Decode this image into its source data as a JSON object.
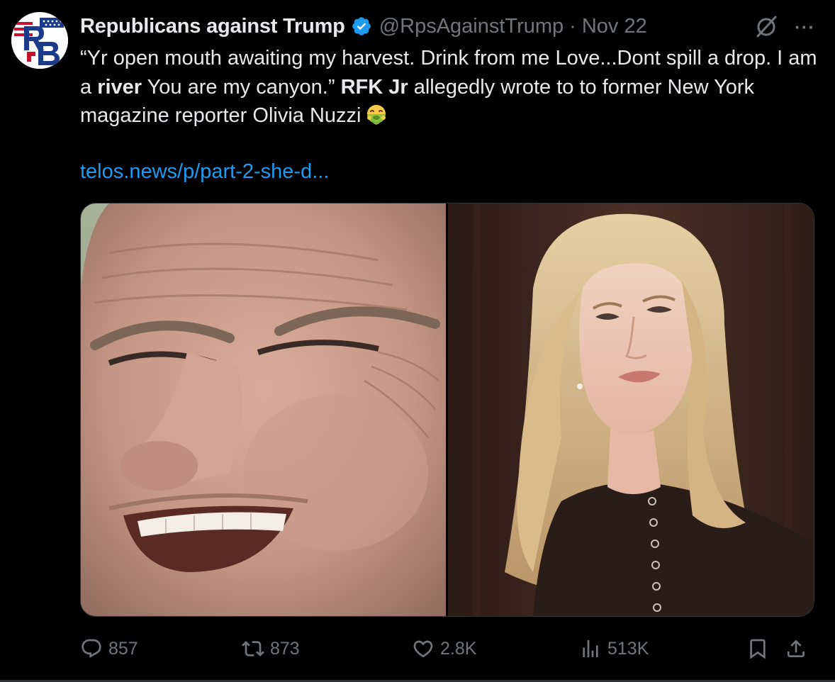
{
  "author": {
    "display_name": "Republicans against Trump",
    "handle": "@RpsAgainstTrump",
    "separator": "·",
    "date": "Nov 22",
    "verified": true,
    "avatar_initials": "RB"
  },
  "tweet": {
    "segments": [
      {
        "text": "“Yr open mouth awaiting my harvest. Drink from me Love...Dont spill a drop. I am a ",
        "bold": false
      },
      {
        "text": "river",
        "bold": true
      },
      {
        "text": " You are my canyon.” ",
        "bold": false
      },
      {
        "text": "RFK Jr",
        "bold": true
      },
      {
        "text": " allegedly wrote to to former New York magazine reporter Olivia Nuzzi",
        "bold": false
      }
    ],
    "emoji": "face-vomiting-emoji",
    "link_text": "telos.news/p/part-2-she-d..."
  },
  "media": {
    "images": [
      {
        "name": "photo-man-smiling"
      },
      {
        "name": "photo-woman-blonde"
      }
    ]
  },
  "actions": {
    "replies": "857",
    "reposts": "873",
    "likes": "2.8K",
    "views": "513K"
  },
  "icons": {
    "grok": "grok-icon",
    "more": "more-icon",
    "reply": "reply-icon",
    "repost": "repost-icon",
    "like": "heart-icon",
    "views": "views-icon",
    "bookmark": "bookmark-icon",
    "share": "share-icon"
  },
  "colors": {
    "background": "#000000",
    "text": "#e7e9ea",
    "muted": "#71767b",
    "link": "#1d9bf0",
    "verified": "#1d9bf0",
    "border": "#2f3336"
  }
}
